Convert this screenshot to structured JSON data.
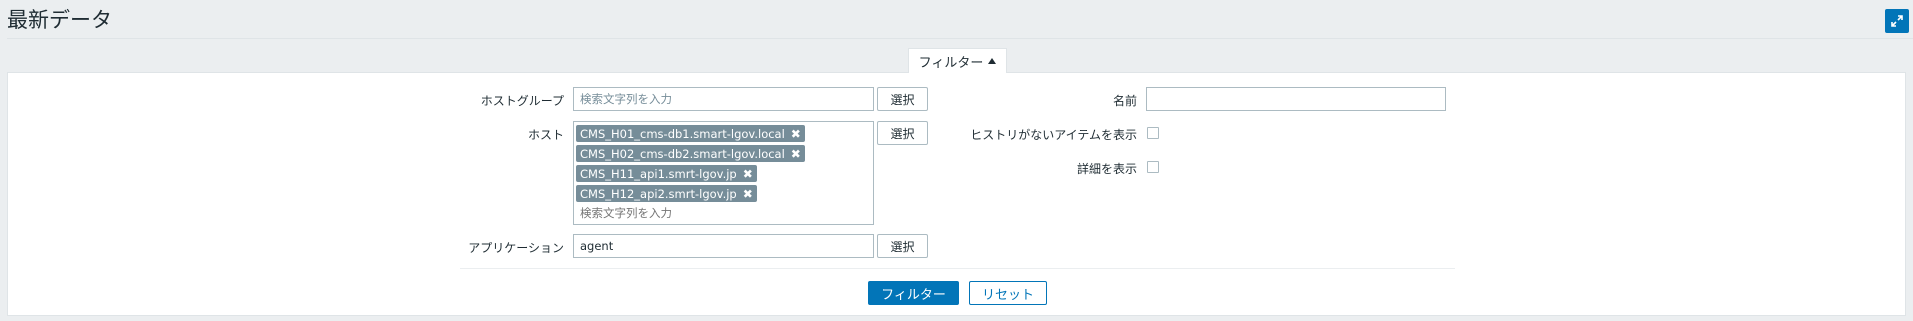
{
  "page": {
    "title": "最新データ"
  },
  "filter": {
    "tab_label": "フィルター",
    "host_group": {
      "label": "ホストグループ",
      "placeholder": "検索文字列を入力",
      "select_label": "選択"
    },
    "host": {
      "label": "ホスト",
      "selected": [
        "CMS_H01_cms-db1.smart-lgov.local",
        "CMS_H02_cms-db2.smart-lgov.local",
        "CMS_H11_api1.smrt-lgov.jp",
        "CMS_H12_api2.smrt-lgov.jp"
      ],
      "placeholder": "検索文字列を入力",
      "select_label": "選択"
    },
    "application": {
      "label": "アプリケーション",
      "value": "agent",
      "select_label": "選択"
    },
    "name": {
      "label": "名前",
      "value": ""
    },
    "show_items_without_history": {
      "label": "ヒストリがないアイテムを表示",
      "checked": false
    },
    "show_details": {
      "label": "詳細を表示",
      "checked": false
    },
    "apply_label": "フィルター",
    "reset_label": "リセット"
  },
  "colors": {
    "accent": "#0275b8",
    "tag_bg": "#768d99",
    "background": "#ebeef0"
  }
}
